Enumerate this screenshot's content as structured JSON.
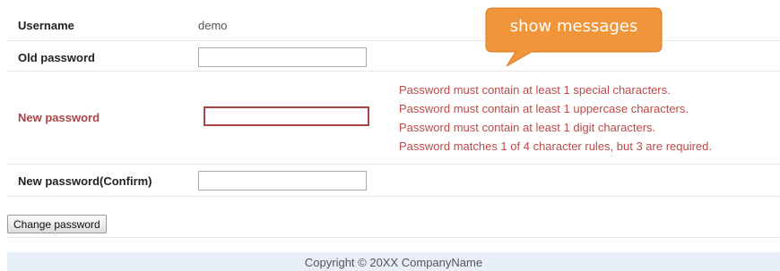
{
  "form": {
    "username": {
      "label": "Username",
      "value": "demo"
    },
    "old_password": {
      "label": "Old password",
      "value": ""
    },
    "new_password": {
      "label": "New password",
      "value": "",
      "error_color": "#a94442"
    },
    "confirm_password": {
      "label": "New password(Confirm)",
      "value": ""
    }
  },
  "validation_messages": [
    "Password must contain at least 1 special characters.",
    "Password must contain at least 1 uppercase characters.",
    "Password must contain at least 1 digit characters.",
    "Password matches 1 of 4 character rules, but 3 are required."
  ],
  "submit_button": {
    "label": "Change password"
  },
  "footer": {
    "text": "Copyright © 20XX CompanyName"
  },
  "callout": {
    "text": "show messages",
    "color": "#f0953a"
  }
}
